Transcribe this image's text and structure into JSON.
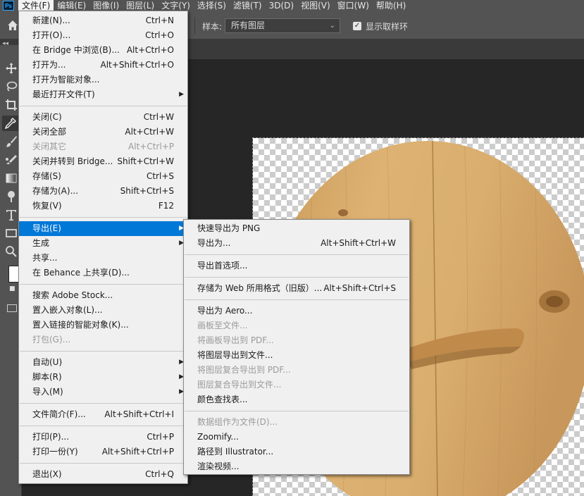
{
  "app": {
    "logo_text": "Ps"
  },
  "menubar": [
    {
      "label": "文件(F)",
      "active": true
    },
    {
      "label": "编辑(E)"
    },
    {
      "label": "图像(I)"
    },
    {
      "label": "图层(L)"
    },
    {
      "label": "文字(Y)"
    },
    {
      "label": "选择(S)"
    },
    {
      "label": "滤镜(T)"
    },
    {
      "label": "3D(D)"
    },
    {
      "label": "视图(V)"
    },
    {
      "label": "窗口(W)"
    },
    {
      "label": "帮助(H)"
    }
  ],
  "options": {
    "sample_label": "样本:",
    "sample_value": "所有图层",
    "show_ring_label": "显示取样环",
    "show_ring_checked": true
  },
  "file_menu": [
    {
      "label": "新建(N)...",
      "shortcut": "Ctrl+N"
    },
    {
      "label": "打开(O)...",
      "shortcut": "Ctrl+O"
    },
    {
      "label": "在 Bridge 中浏览(B)...",
      "shortcut": "Alt+Ctrl+O"
    },
    {
      "label": "打开为...",
      "shortcut": "Alt+Shift+Ctrl+O"
    },
    {
      "label": "打开为智能对象..."
    },
    {
      "label": "最近打开文件(T)",
      "submenu": true
    },
    {
      "separator": true
    },
    {
      "label": "关闭(C)",
      "shortcut": "Ctrl+W"
    },
    {
      "label": "关闭全部",
      "shortcut": "Alt+Ctrl+W"
    },
    {
      "label": "关闭其它",
      "shortcut": "Alt+Ctrl+P",
      "disabled": true
    },
    {
      "label": "关闭并转到 Bridge...",
      "shortcut": "Shift+Ctrl+W"
    },
    {
      "label": "存储(S)",
      "shortcut": "Ctrl+S"
    },
    {
      "label": "存储为(A)...",
      "shortcut": "Shift+Ctrl+S"
    },
    {
      "label": "恢复(V)",
      "shortcut": "F12"
    },
    {
      "separator": true
    },
    {
      "label": "导出(E)",
      "submenu": true,
      "highlighted": true
    },
    {
      "label": "生成",
      "submenu": true
    },
    {
      "label": "共享..."
    },
    {
      "label": "在 Behance 上共享(D)..."
    },
    {
      "separator": true
    },
    {
      "label": "搜索 Adobe Stock..."
    },
    {
      "label": "置入嵌入对象(L)..."
    },
    {
      "label": "置入链接的智能对象(K)..."
    },
    {
      "label": "打包(G)...",
      "disabled": true
    },
    {
      "separator": true
    },
    {
      "label": "自动(U)",
      "submenu": true
    },
    {
      "label": "脚本(R)",
      "submenu": true
    },
    {
      "label": "导入(M)",
      "submenu": true
    },
    {
      "separator": true
    },
    {
      "label": "文件简介(F)...",
      "shortcut": "Alt+Shift+Ctrl+I"
    },
    {
      "separator": true
    },
    {
      "label": "打印(P)...",
      "shortcut": "Ctrl+P"
    },
    {
      "label": "打印一份(Y)",
      "shortcut": "Alt+Shift+Ctrl+P"
    },
    {
      "separator": true
    },
    {
      "label": "退出(X)",
      "shortcut": "Ctrl+Q"
    }
  ],
  "export_submenu": [
    {
      "label": "快速导出为 PNG"
    },
    {
      "label": "导出为...",
      "shortcut": "Alt+Shift+Ctrl+W"
    },
    {
      "separator": true
    },
    {
      "label": "导出首选项..."
    },
    {
      "separator": true
    },
    {
      "label": "存储为 Web 所用格式（旧版）...",
      "shortcut": "Alt+Shift+Ctrl+S"
    },
    {
      "separator": true
    },
    {
      "label": "导出为 Aero..."
    },
    {
      "label": "画板至文件...",
      "disabled": true
    },
    {
      "label": "将画板导出到 PDF...",
      "disabled": true
    },
    {
      "label": "将图层导出到文件..."
    },
    {
      "label": "将图层复合导出到 PDF...",
      "disabled": true
    },
    {
      "label": "图层复合导出到文件...",
      "disabled": true
    },
    {
      "label": "颜色查找表..."
    },
    {
      "separator": true
    },
    {
      "label": "数据组作为文件(D)...",
      "disabled": true
    },
    {
      "label": "Zoomify..."
    },
    {
      "label": "路径到 Illustrator..."
    },
    {
      "label": "渲染视频..."
    }
  ]
}
